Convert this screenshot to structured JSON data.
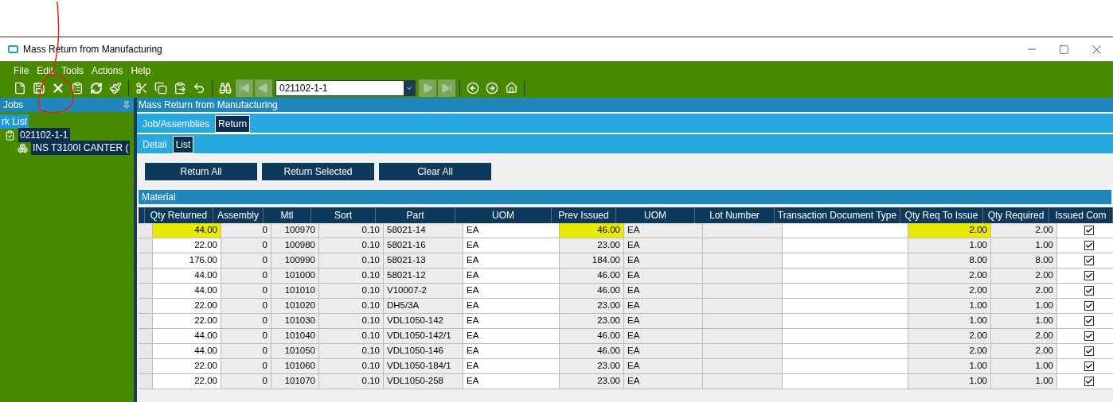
{
  "window": {
    "title": "Mass Return from Manufacturing"
  },
  "menu": [
    "File",
    "Edit",
    "Tools",
    "Actions",
    "Help"
  ],
  "toolbar": {
    "record": "021102-1-1",
    "nav_buttons": [
      {
        "disabled": true
      },
      {
        "disabled": true
      },
      {
        "disabled": true
      },
      {
        "disabled": true
      }
    ]
  },
  "left_panel": {
    "title": "Jobs",
    "section": "rk List",
    "tree": [
      {
        "label": "021102-1-1",
        "selected": true,
        "children": [
          {
            "label": "INS T3100I CANTER (",
            "selected": true
          }
        ]
      }
    ]
  },
  "main": {
    "title": "Mass Return from Manufacturing",
    "tabs": [
      {
        "label": "Job/Assemblies",
        "selected": false
      },
      {
        "label": "Return",
        "selected": true
      }
    ],
    "subtabs": [
      {
        "label": "Detail",
        "selected": false
      },
      {
        "label": "List",
        "selected": true
      }
    ],
    "buttons": [
      "Return All",
      "Return Selected",
      "Clear All"
    ],
    "section_title": "Material",
    "table": {
      "columns": [
        {
          "label": "Qty Returned",
          "kind": "number",
          "editable": true,
          "highlighted": true
        },
        {
          "label": "Assembly",
          "kind": "number",
          "editable": false,
          "highlighted": false
        },
        {
          "label": "Mtl",
          "kind": "number",
          "editable": false,
          "highlighted": false
        },
        {
          "label": "Sort",
          "kind": "number",
          "editable": false,
          "highlighted": false
        },
        {
          "label": "Part",
          "kind": "text",
          "editable": false,
          "highlighted": false
        },
        {
          "label": "UOM",
          "kind": "text",
          "editable": true,
          "highlighted": false
        },
        {
          "label": "Prev Issued",
          "kind": "number",
          "editable": false,
          "highlighted": true
        },
        {
          "label": "UOM",
          "kind": "text",
          "editable": false,
          "highlighted": false
        },
        {
          "label": "Lot Number",
          "kind": "text",
          "editable": false,
          "highlighted": false
        },
        {
          "label": "Transaction Document Type",
          "kind": "text",
          "editable": true,
          "highlighted": false
        },
        {
          "label": "Qty Req To Issue",
          "kind": "number",
          "editable": false,
          "highlighted": true
        },
        {
          "label": "Qty Required",
          "kind": "number",
          "editable": false,
          "highlighted": false
        },
        {
          "label": "Issued Com",
          "kind": "check",
          "editable": true,
          "highlighted": false
        }
      ],
      "rows": [
        {
          "highlighted": true,
          "cells": [
            "44.00",
            "0",
            "100970",
            "0.10",
            "58021-14",
            "EA",
            "46.00",
            "EA",
            "",
            "",
            "2.00",
            "2.00"
          ],
          "checked": true
        },
        {
          "highlighted": false,
          "cells": [
            "22.00",
            "0",
            "100980",
            "0.10",
            "58021-16",
            "EA",
            "23.00",
            "EA",
            "",
            "",
            "1.00",
            "1.00"
          ],
          "checked": true
        },
        {
          "highlighted": false,
          "cells": [
            "176.00",
            "0",
            "100990",
            "0.10",
            "58021-13",
            "EA",
            "184.00",
            "EA",
            "",
            "",
            "8.00",
            "8.00"
          ],
          "checked": true
        },
        {
          "highlighted": false,
          "cells": [
            "44.00",
            "0",
            "101000",
            "0.10",
            "58021-12",
            "EA",
            "46.00",
            "EA",
            "",
            "",
            "2.00",
            "2.00"
          ],
          "checked": true
        },
        {
          "highlighted": false,
          "cells": [
            "44.00",
            "0",
            "101010",
            "0.10",
            "V10007-2",
            "EA",
            "46.00",
            "EA",
            "",
            "",
            "2.00",
            "2.00"
          ],
          "checked": true
        },
        {
          "highlighted": false,
          "cells": [
            "22.00",
            "0",
            "101020",
            "0.10",
            "DH5/3A",
            "EA",
            "23.00",
            "EA",
            "",
            "",
            "1.00",
            "1.00"
          ],
          "checked": true
        },
        {
          "highlighted": false,
          "cells": [
            "22.00",
            "0",
            "101030",
            "0.10",
            "VDL1050-142",
            "EA",
            "23.00",
            "EA",
            "",
            "",
            "1.00",
            "1.00"
          ],
          "checked": true
        },
        {
          "highlighted": false,
          "cells": [
            "44.00",
            "0",
            "101040",
            "0.10",
            "VDL1050-142/1",
            "EA",
            "46.00",
            "EA",
            "",
            "",
            "2.00",
            "2.00"
          ],
          "checked": true
        },
        {
          "highlighted": false,
          "cells": [
            "44.00",
            "0",
            "101050",
            "0.10",
            "VDL1050-146",
            "EA",
            "46.00",
            "EA",
            "",
            "",
            "2.00",
            "2.00"
          ],
          "checked": true
        },
        {
          "highlighted": false,
          "cells": [
            "22.00",
            "0",
            "101060",
            "0.10",
            "VDL1050-184/1",
            "EA",
            "23.00",
            "EA",
            "",
            "",
            "1.00",
            "1.00"
          ],
          "checked": true
        },
        {
          "highlighted": false,
          "cells": [
            "22.00",
            "0",
            "101070",
            "0.10",
            "VDL1050-258",
            "EA",
            "23.00",
            "EA",
            "",
            "",
            "1.00",
            "1.00"
          ],
          "checked": true
        }
      ]
    }
  }
}
